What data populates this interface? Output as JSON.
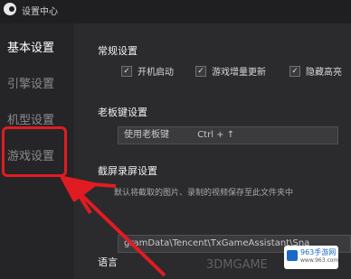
{
  "app": {
    "title": "设置中心",
    "logo_icon": "app-logo-icon"
  },
  "sidebar": {
    "items": [
      {
        "label": "基本设置",
        "active": true
      },
      {
        "label": "引擎设置",
        "active": false
      },
      {
        "label": "机型设置",
        "active": false
      },
      {
        "label": "游戏设置",
        "active": false
      }
    ]
  },
  "sections": {
    "general": {
      "title": "常规设置",
      "options": [
        {
          "label": "开机启动",
          "checked": true
        },
        {
          "label": "游戏增量更新",
          "checked": true
        },
        {
          "label": "隐藏高亮",
          "checked": true
        }
      ]
    },
    "boss_key": {
      "title": "老板键设置",
      "field_value": "使用老板键",
      "hotkey": "Ctrl + ↑"
    },
    "capture": {
      "title": "截屏录屏设置",
      "hint": "默认将截取的图片、录制的视频保存至此文件夹中",
      "path_value": "gramData\\Tencent\\TxGameAssistant\\Sna"
    },
    "language": {
      "title": "语言"
    }
  },
  "watermark": {
    "text": "3DMGAME",
    "badge_title": "963手游网",
    "badge_sub": "www.963.com"
  },
  "colors": {
    "accent": "#e11b22",
    "background": "#2b2b2d",
    "sidebar": "#252527"
  }
}
